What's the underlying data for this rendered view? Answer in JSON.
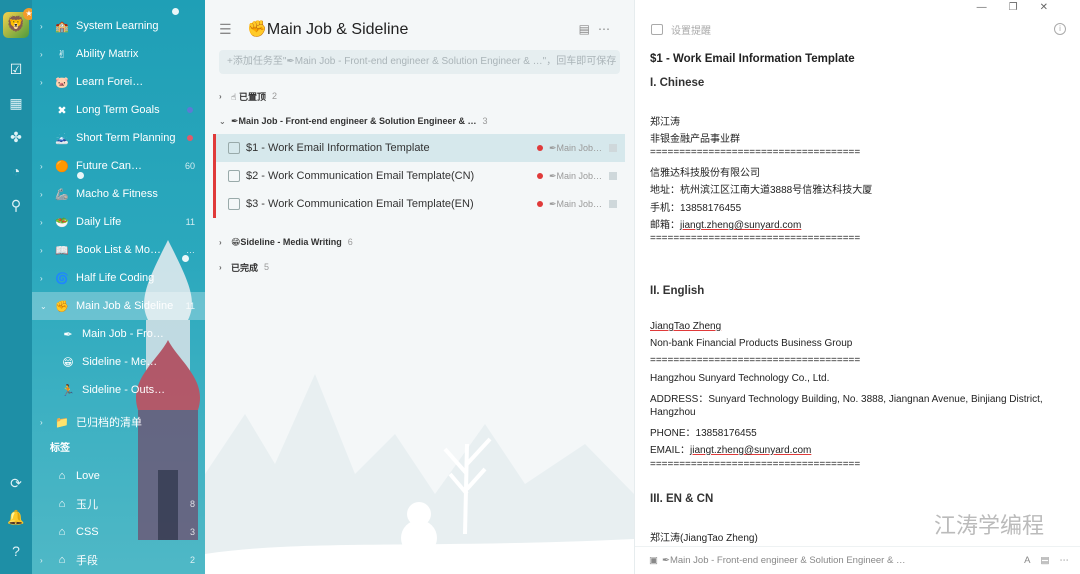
{
  "rail": {
    "icons": [
      "checkbox-icon",
      "calendar-icon",
      "grid-icon",
      "clock-icon",
      "search-icon"
    ],
    "bottom_icons": [
      "sync-icon",
      "bell-icon",
      "help-icon"
    ]
  },
  "sidebar": {
    "items": [
      {
        "label": "System Learning",
        "icon": "🏫",
        "count": ""
      },
      {
        "label": "Ability Matrix",
        "icon": "✌",
        "count": ""
      },
      {
        "label": "Learn Forei…",
        "icon": "🐷",
        "count": ""
      },
      {
        "label": "Long Term Goals",
        "icon": "✖",
        "count": ""
      },
      {
        "label": "Short Term Planning",
        "icon": "🗻",
        "count": ""
      },
      {
        "label": "Future Can…",
        "icon": "🟠",
        "count": "60"
      },
      {
        "label": "Macho & Fitness",
        "icon": "🦾",
        "count": ""
      },
      {
        "label": "Daily Life",
        "icon": "🥗",
        "count": "11"
      },
      {
        "label": "Book List & Mo…",
        "icon": "📖",
        "count": "…"
      },
      {
        "label": "Half Life Coding",
        "icon": "🌀",
        "count": ""
      },
      {
        "label": "Main Job & Sideline",
        "icon": "✊",
        "count": "11"
      }
    ],
    "subitems": [
      {
        "label": "Main Job - Fro…",
        "icon": "✒"
      },
      {
        "label": "Sideline - Me…",
        "icon": "😁"
      },
      {
        "label": "Sideline - Outs…",
        "icon": "🏃"
      }
    ],
    "archived": {
      "label": "已归档的清单",
      "icon": "📁"
    },
    "tags_header": "标签",
    "tags": [
      {
        "label": "Love",
        "count": ""
      },
      {
        "label": "玉儿",
        "count": "8"
      },
      {
        "label": "CSS",
        "count": "3"
      },
      {
        "label": "手段",
        "count": "2"
      }
    ]
  },
  "list": {
    "title": "✊Main Job & Sideline",
    "add_placeholder": "+添加任务至\"✒Main Job - Front-end engineer & Solution Engineer & …\"，回车即可保存",
    "groups": {
      "pinned": {
        "label": "☝ 已置顶",
        "count": "2"
      },
      "main": {
        "label": "✒Main Job - Front-end engineer & Solution Engineer & …",
        "count": "3"
      },
      "sideline": {
        "label": "😁Sideline - Media Writing",
        "count": "6"
      },
      "done": {
        "label": "已完成",
        "count": "5"
      }
    },
    "tasks": [
      {
        "title": "$1 - Work Email Information Template",
        "list": "✒Main Job…"
      },
      {
        "title": "$2 - Work Communication Email Template(CN)",
        "list": "✒Main Job…"
      },
      {
        "title": "$3 - Work Communication Email Template(EN)",
        "list": "✒Main Job…"
      }
    ]
  },
  "detail": {
    "reminder_label": "设置提醒",
    "title": "$1 - Work Email Information Template",
    "h1": "I. Chinese",
    "cn": {
      "name": "郑江涛",
      "dept": "非银金融产品事业群",
      "sep": "====================================",
      "company": "信雅达科技股份有限公司",
      "addr": "地址：杭州滨江区江南大道3888号信雅达科技大厦",
      "phone": "手机：13858176455",
      "email_label": "邮箱：",
      "email": "jiangt.zheng@sunyard.com"
    },
    "h2": "II. English",
    "en": {
      "name": "JiangTao Zheng",
      "dept": "Non-bank Financial Products Business Group",
      "company": "Hangzhou Sunyard Technology Co., Ltd.",
      "addr": "ADDRESS：Sunyard Technology Building, No. 3888, Jiangnan Avenue, Binjiang District,",
      "addr2": "Hangzhou",
      "phone": "PHONE：13858176455",
      "email_label": "EMAIL：",
      "email": "jiangt.zheng@sunyard.com"
    },
    "h3": "III. EN & CN",
    "combo_name": "郑江涛(JiangTao Zheng)",
    "footer_list": "✒Main Job - Front-end engineer & Solution Engineer & …"
  },
  "watermark": "江涛学编程"
}
